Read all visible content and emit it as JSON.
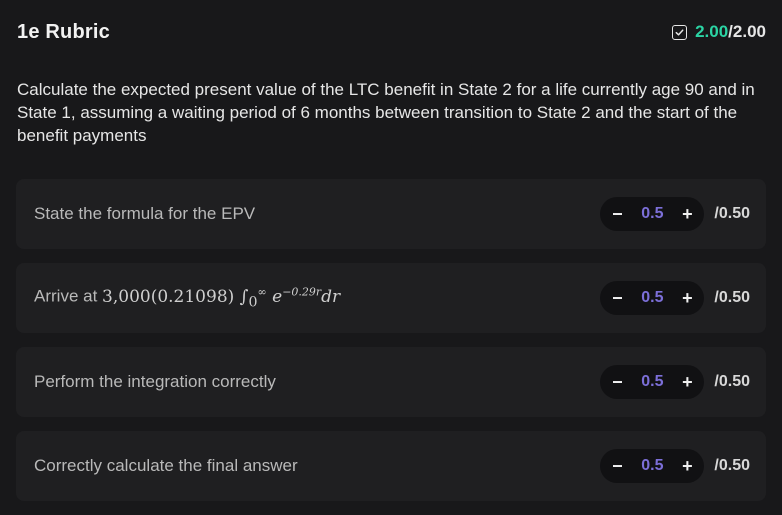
{
  "header": {
    "title": "1e Rubric",
    "score_earned": "2.00",
    "score_separator": "/",
    "score_total": "2.00",
    "check_icon": "check-square-icon"
  },
  "question": {
    "text": "Calculate the expected present value of the LTC benefit in State 2 for a life currently age 90 and in State 1, assuming a waiting period of 6 months between transition to State 2 and the start of the benefit payments"
  },
  "criteria": [
    {
      "label": "State the formula for the EPV",
      "value": "0.5",
      "max": "/0.50"
    },
    {
      "label_prefix": "Arrive at",
      "formula": {
        "coef": "3,000(0.21098)",
        "integral": "∫",
        "lower": "0",
        "upper": "∞",
        "base": "e",
        "exponent": "−0.29r",
        "dr": "dr"
      },
      "value": "0.5",
      "max": "/0.50"
    },
    {
      "label": "Perform the integration correctly",
      "value": "0.5",
      "max": "/0.50"
    },
    {
      "label": "Correctly calculate the final answer",
      "value": "0.5",
      "max": "/0.50"
    }
  ],
  "controls": {
    "decrement_label": "−",
    "increment_label": "+"
  },
  "colors": {
    "accent_score": "#2bd4a4",
    "points_value": "#7c6fd8",
    "background": "#18181a",
    "card": "#1f1f21"
  }
}
